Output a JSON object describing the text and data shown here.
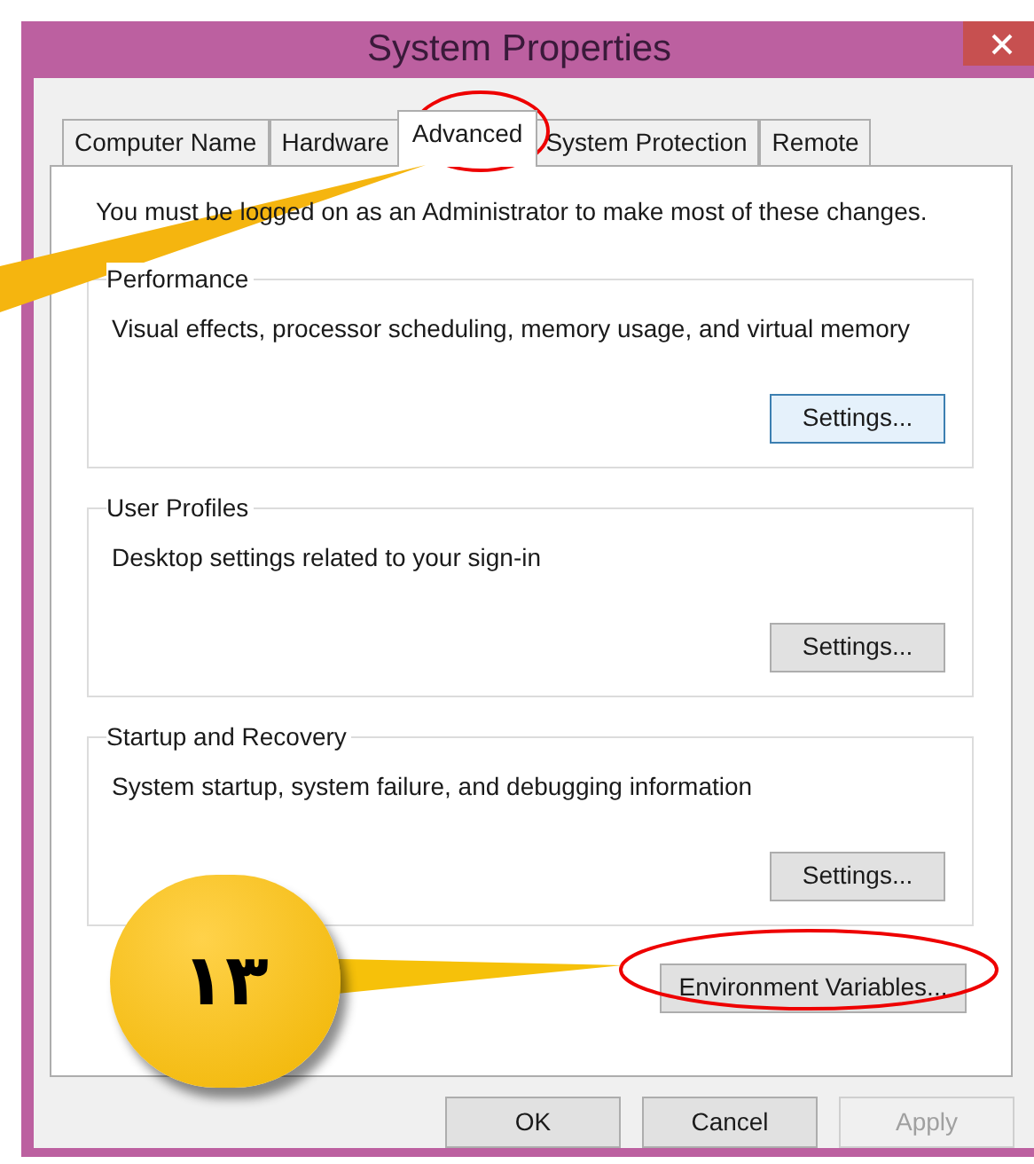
{
  "window": {
    "title": "System Properties"
  },
  "tabs": [
    {
      "label": "Computer Name",
      "selected": false
    },
    {
      "label": "Hardware",
      "selected": false
    },
    {
      "label": "Advanced",
      "selected": true
    },
    {
      "label": "System Protection",
      "selected": false
    },
    {
      "label": "Remote",
      "selected": false
    }
  ],
  "notice": "You must be logged on as an Administrator to make most of these changes.",
  "groups": [
    {
      "title": "Performance",
      "description": "Visual effects, processor scheduling, memory usage, and virtual memory",
      "button": "Settings..."
    },
    {
      "title": "User Profiles",
      "description": "Desktop settings related to your sign-in",
      "button": "Settings..."
    },
    {
      "title": "Startup and Recovery",
      "description": "System startup, system failure, and debugging information",
      "button": "Settings..."
    }
  ],
  "environment_button": "Environment Variables...",
  "buttons": [
    {
      "label": "OK",
      "disabled": false
    },
    {
      "label": "Cancel",
      "disabled": false
    },
    {
      "label": "Apply",
      "disabled": true
    }
  ],
  "callout": {
    "label": "١٣"
  }
}
